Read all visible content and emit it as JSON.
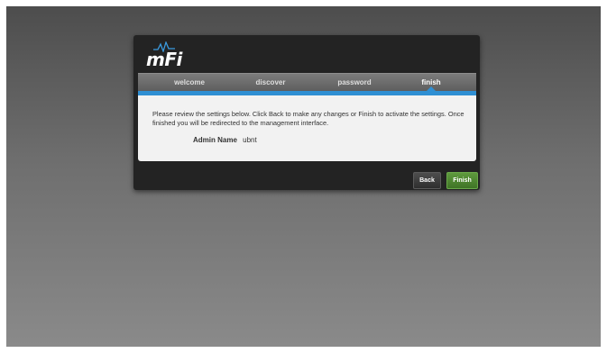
{
  "app": {
    "logo_text": "mFi"
  },
  "tabs": [
    {
      "label": "welcome",
      "active": false
    },
    {
      "label": "discover",
      "active": false
    },
    {
      "label": "password",
      "active": false
    },
    {
      "label": "finish",
      "active": true
    }
  ],
  "content": {
    "review_text": "Please review the settings below. Click Back to make any changes or Finish to activate the settings. Once finished you will be redirected to the management interface.",
    "fields": [
      {
        "label": "Admin Name",
        "value": "ubnt"
      }
    ]
  },
  "buttons": {
    "back_label": "Back",
    "finish_label": "Finish"
  },
  "colors": {
    "accent": "#2f8fd3",
    "finish_button": "#4f8a30",
    "panel": "#232323"
  }
}
